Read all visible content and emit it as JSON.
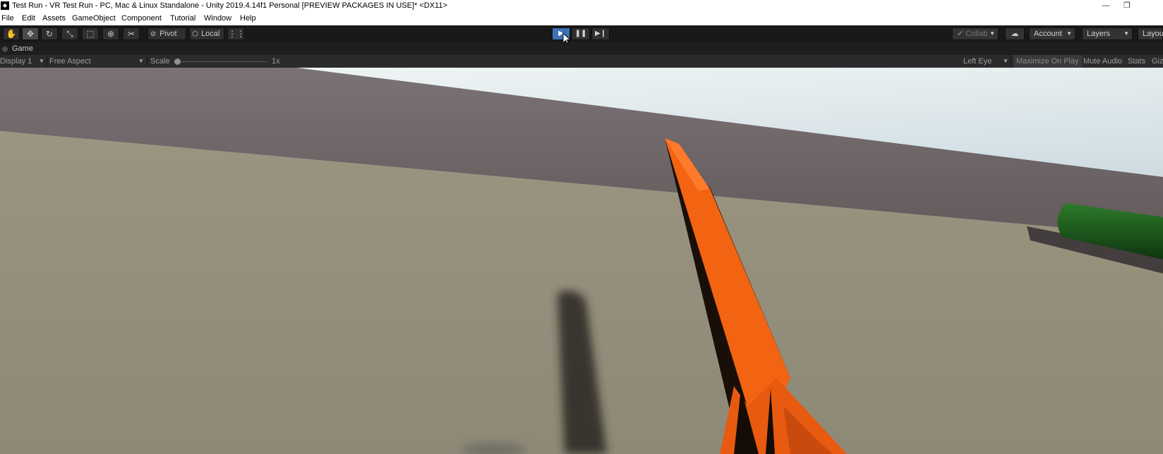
{
  "window": {
    "title": "Test Run - VR Test Run - PC, Mac & Linux Standalone - Unity 2019.4.14f1 Personal [PREVIEW PACKAGES IN USE]* <DX11>",
    "app_icon": "unity-logo-icon",
    "minimize_symbol": "—",
    "restore_symbol": "❐"
  },
  "menu": {
    "items": [
      "File",
      "Edit",
      "Assets",
      "GameObject",
      "Component",
      "Tutorial",
      "Window",
      "Help"
    ]
  },
  "toolbar": {
    "tools": [
      {
        "name": "hand-tool",
        "glyph": "✋"
      },
      {
        "name": "move-tool",
        "glyph": "✥"
      },
      {
        "name": "rotate-tool",
        "glyph": "↻"
      },
      {
        "name": "scale-tool",
        "glyph": "⤡"
      },
      {
        "name": "rect-tool",
        "glyph": "⬚"
      },
      {
        "name": "transform-tool",
        "glyph": "⊕"
      },
      {
        "name": "custom-tool",
        "glyph": "✂"
      }
    ],
    "pivot_label": "Pivot",
    "local_label": "Local",
    "snap_glyph": "⋮⋮",
    "play_glyph": "▶",
    "pause_glyph": "❚❚",
    "step_glyph": "▶❙",
    "collab_label": "Collab",
    "collab_glyph": "✔",
    "cloud_glyph": "☁",
    "account_label": "Account",
    "layers_label": "Layers",
    "layout_label": "Layou",
    "dropdown_arrow": "▼"
  },
  "game_tab": {
    "label": "Game",
    "icon": "game-controller-icon",
    "icon_glyph": "◎"
  },
  "game_toolbar": {
    "display": "Display 1",
    "aspect": "Free Aspect",
    "scale_label": "Scale",
    "scale_value": "1x",
    "scale_fraction": 0.0,
    "eye": "Left Eye",
    "maximize": "Maximize On Play",
    "mute": "Mute Audio",
    "stats": "Stats",
    "gizmos": "Giz",
    "dropdown_arrow": "▼"
  },
  "colors": {
    "accent_play": "#3a72b8",
    "toolbar_bg": "#191919",
    "sky": "#dde6ea",
    "wall": "#6e6667",
    "floor": "#948f7c",
    "sword_orange": "#f26412",
    "green_object": "#1e5a1e"
  }
}
